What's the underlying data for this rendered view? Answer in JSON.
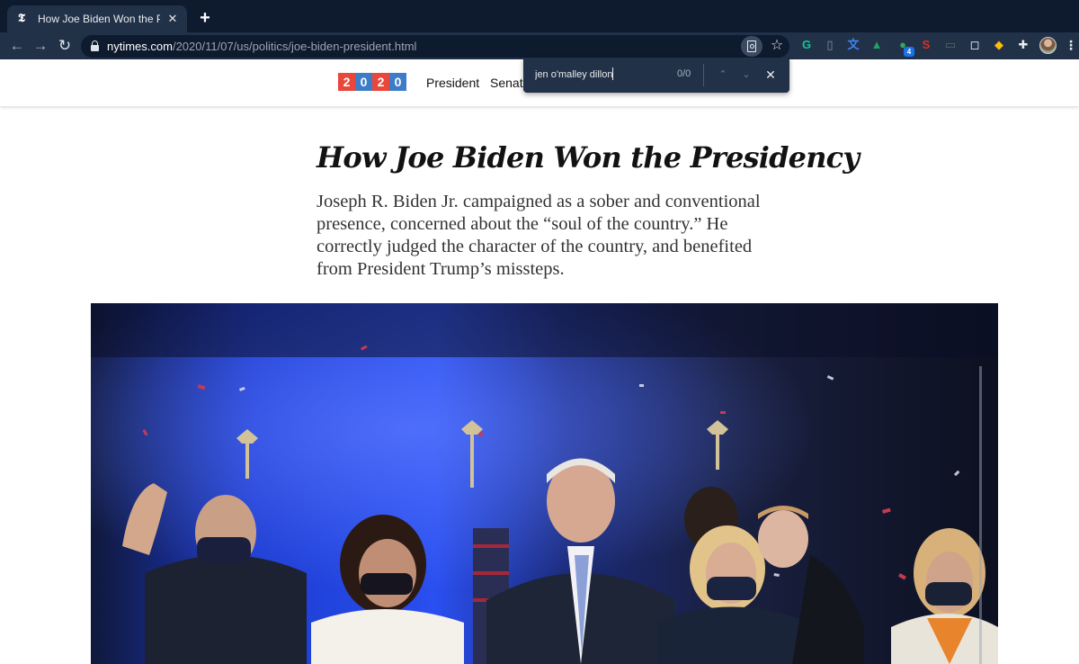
{
  "browser": {
    "tab": {
      "title": "How Joe Biden Won the Presid",
      "favicon": "𝕿"
    },
    "new_tab_label": "+",
    "url_host": "nytimes.com",
    "url_path": "/2020/11/07/us/politics/joe-biden-president.html",
    "extensions": [
      {
        "name": "grammarly-icon",
        "color": "#15c39a",
        "glyph": "G"
      },
      {
        "name": "extension-doc-icon",
        "color": "#8c9099",
        "glyph": "▯"
      },
      {
        "name": "google-translate-icon",
        "color": "#4285f4",
        "glyph": "文"
      },
      {
        "name": "google-drive-icon",
        "color": "#1fa463",
        "glyph": "▲"
      },
      {
        "name": "extension-green-icon",
        "color": "#34a853",
        "glyph": "●"
      },
      {
        "name": "extension-s-icon",
        "color": "#d93025",
        "glyph": "S"
      },
      {
        "name": "extension-card-icon",
        "color": "#5f6368",
        "glyph": "▭"
      },
      {
        "name": "extension-window-icon",
        "color": "#ffffff",
        "glyph": "◻"
      },
      {
        "name": "extension-colorful-icon",
        "color": "#fbbc04",
        "glyph": "◆"
      },
      {
        "name": "puzzle-icon",
        "color": "#e8eaed",
        "glyph": "✚"
      }
    ],
    "extension_badge": "4"
  },
  "find_bar": {
    "query": "jen o'malley dillon",
    "count": "0/0",
    "prev_glyph": "⌃",
    "next_glyph": "⌄",
    "close_glyph": "✕"
  },
  "site_nav": {
    "logo_digits": [
      "2",
      "0",
      "2",
      "0"
    ],
    "logo_colors": [
      "#e8473a",
      "#3d7cc9",
      "#e8473a",
      "#3d7cc9"
    ],
    "links": [
      "President",
      "Senate"
    ]
  },
  "article": {
    "headline": "How Joe Biden Won the Presidency",
    "summary": "Joseph R. Biden Jr. campaigned as a sober and conventional presence, concerned about the “soul of the country.” He correctly judged the character of the country, and benefited from President Trump’s missteps."
  }
}
